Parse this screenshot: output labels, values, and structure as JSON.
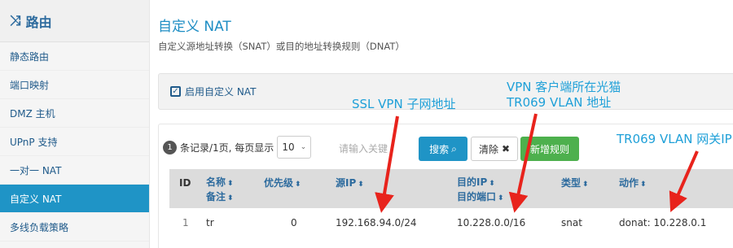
{
  "sidebar": {
    "title": "路由",
    "icon": "shuffle-icon",
    "items": [
      {
        "label": "静态路由"
      },
      {
        "label": "端口映射"
      },
      {
        "label": "DMZ 主机"
      },
      {
        "label": "UPnP 支持"
      },
      {
        "label": "一对一 NAT"
      },
      {
        "label": "自定义 NAT",
        "active": true
      },
      {
        "label": "多线负载策略"
      }
    ]
  },
  "main": {
    "title": "自定义 NAT",
    "description": "自定义源地址转换（SNAT）或目的地址转换规则（DNAT）",
    "enable_label": "启用自定义 NAT",
    "enable_checked": true
  },
  "toolbar": {
    "page_count": "1",
    "records_text": "条记录/1页, 每页显示",
    "page_size": "10",
    "search_placeholder": "请输入关键",
    "search_label": "搜索",
    "clear_label": "清除",
    "add_label": "新增规则"
  },
  "table": {
    "headers": {
      "id": "ID",
      "name": "名称",
      "remark": "备注",
      "priority": "优先级",
      "src_ip": "源IP",
      "dst_ip": "目的IP",
      "dst_port": "目的端口",
      "type": "类型",
      "action": "动作"
    },
    "rows": [
      {
        "id": "1",
        "name": "tr",
        "priority": "0",
        "src_ip": "192.168.94.0/24",
        "dst_ip": "10.228.0.0/16",
        "type": "snat",
        "action": "donat: 10.228.0.1"
      }
    ]
  },
  "annotations": {
    "ssl_vpn": "SSL VPN 子网地址",
    "vpn_client_1": "VPN 客户端所在光猫",
    "vpn_client_2": "TR069 VLAN 地址",
    "tr069_gw": "TR069 VLAN 网关IP",
    "arrow_color": "#e8231c"
  }
}
